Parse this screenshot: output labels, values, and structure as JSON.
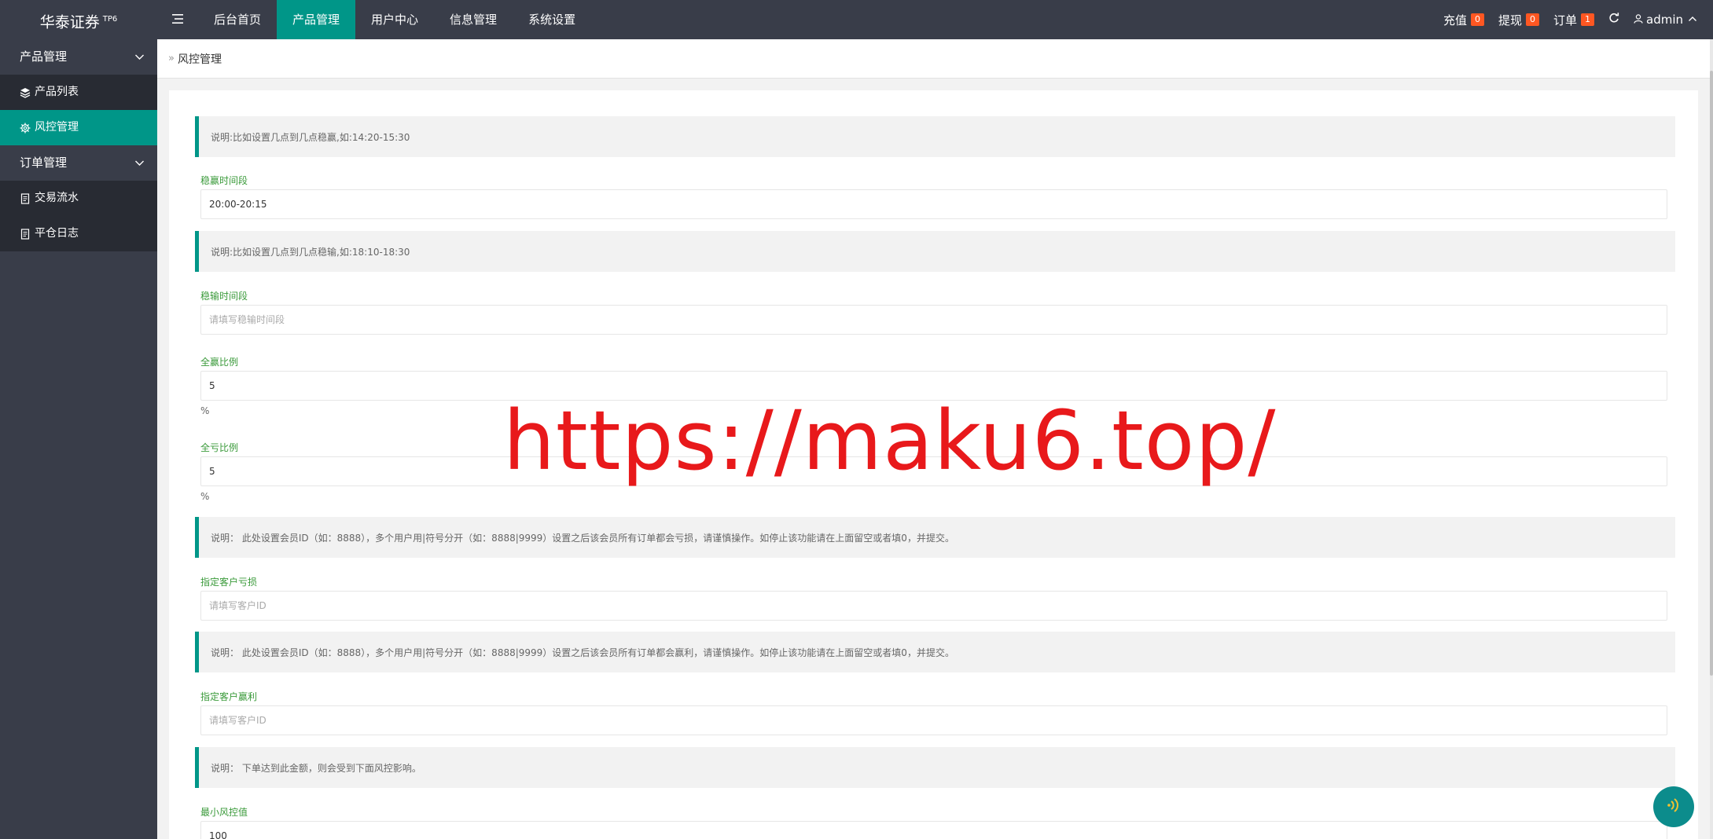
{
  "brand": {
    "name": "华泰证券",
    "tag": "TP6"
  },
  "topnav": [
    {
      "label": "后台首页"
    },
    {
      "label": "产品管理"
    },
    {
      "label": "用户中心"
    },
    {
      "label": "信息管理"
    },
    {
      "label": "系统设置"
    }
  ],
  "topright": {
    "recharge_label": "充值",
    "recharge_count": "0",
    "withdraw_label": "提现",
    "withdraw_count": "0",
    "order_label": "订单",
    "order_count": "1",
    "user_name": "admin"
  },
  "sidebar": {
    "group1": "产品管理",
    "items1": [
      "产品列表",
      "风控管理"
    ],
    "group2": "订单管理",
    "items2": [
      "交易流水",
      "平仓日志"
    ]
  },
  "breadcrumb": {
    "sep": "»",
    "current": "风控管理"
  },
  "form": {
    "note1": "说明:比如设置几点到几点稳赢,如:14:20-15:30",
    "win_time_label": "稳赢时间段",
    "win_time_value": "20:00-20:15",
    "note2": "说明:比如设置几点到几点稳输,如:18:10-18:30",
    "lose_time_label": "稳输时间段",
    "lose_time_placeholder": "请填写稳输时间段",
    "win_ratio_label": "全赢比例",
    "win_ratio_value": "5",
    "win_ratio_unit": "%",
    "loss_ratio_label": "全亏比例",
    "loss_ratio_value": "5",
    "loss_ratio_unit": "%",
    "note3": "说明： 此处设置会员ID（如：8888），多个用户用|符号分开（如：8888|9999）设置之后该会员所有订单都会亏损，请谨慎操作。如停止该功能请在上面留空或者填0，并提交。",
    "loss_user_label": "指定客户亏损",
    "loss_user_placeholder": "请填写客户ID",
    "note4": "说明： 此处设置会员ID（如：8888），多个用户用|符号分开（如：8888|9999）设置之后该会员所有订单都会赢利，请谨慎操作。如停止该功能请在上面留空或者填0，并提交。",
    "win_user_label": "指定客户赢利",
    "win_user_placeholder": "请填写客户ID",
    "note5": "说明： 下单达到此金额，则会受到下面风控影响。",
    "min_risk_label": "最小风控值",
    "min_risk_value": "100"
  },
  "watermark": "https://maku6.top/",
  "colors": {
    "topbar": "#393d49",
    "accent": "#009688",
    "badge": "#ff5722",
    "label_green": "#3a9a3a",
    "watermark": "#e8191b"
  }
}
